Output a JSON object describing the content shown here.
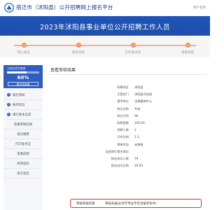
{
  "header": {
    "site_title": "宿迁市（沭阳县）公开招聘网上报名平台",
    "user_name": "用户名称"
  },
  "banner": {
    "title": "2023年沭阳县事业单位公开招聘工作人员"
  },
  "steps": [
    {
      "label": "网上报名"
    },
    {
      "label": "报名审核"
    },
    {
      "label": "打印准考证"
    },
    {
      "label": "查看成绩"
    }
  ],
  "sidebar": {
    "progress_caption": "当前信息完善度",
    "progress_percent": 60,
    "progress_text": "60%",
    "status_label": "报名完成度"
  },
  "menu": [
    {
      "label": "报名须知",
      "checked": true
    },
    {
      "label": "报考岗位",
      "checked": true
    },
    {
      "label": "填写基本信息",
      "checked": true
    },
    {
      "label": "查看审核结果",
      "checked": false
    },
    {
      "label": "报名缴费",
      "checked": false
    },
    {
      "label": "打印准考证",
      "checked": false
    },
    {
      "label": "查看成绩",
      "checked": false
    },
    {
      "label": "修改密码",
      "checked": false
    },
    {
      "label": "安全退出",
      "checked": false
    }
  ],
  "main": {
    "title": "查看审核结果",
    "details": [
      {
        "key": "所属地区",
        "value": "沭阳县"
      },
      {
        "key": "主管部门",
        "value": "沭阳县司法局"
      },
      {
        "key": "报考单位",
        "value": "法律援助中心"
      },
      {
        "key": "岗位名称",
        "value": "专技"
      },
      {
        "key": "岗位代码",
        "value": "06"
      },
      {
        "key": "收费基数",
        "value": "100.00"
      },
      {
        "key": "招聘人数",
        "value": "2"
      },
      {
        "key": "开考比例",
        "value": "1:3"
      },
      {
        "key": "预审状态",
        "value": "未审核"
      },
      {
        "key": "当前岗位报名情况",
        "value": ""
      },
      {
        "key": "报名成功人数",
        "value": "79"
      },
      {
        "key": "报名成功比例",
        "value": "39.50"
      }
    ],
    "result": {
      "key": "审核审核结果",
      "value": "审核未通过(所学专业不符合报考条件)"
    }
  }
}
